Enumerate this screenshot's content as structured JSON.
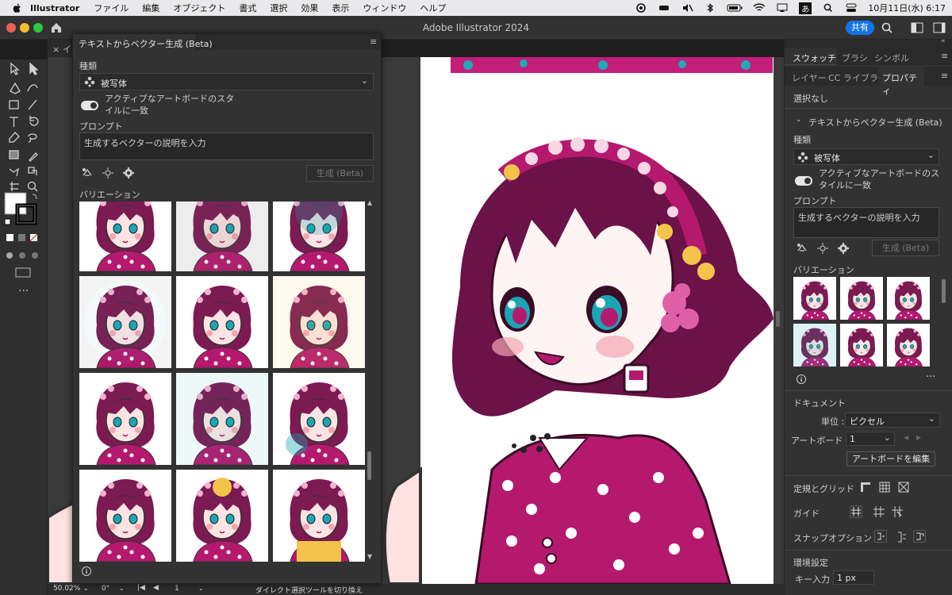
{
  "menubar": {
    "app": "Illustrator",
    "items": [
      "ファイル",
      "編集",
      "オブジェクト",
      "書式",
      "選択",
      "効果",
      "表示",
      "ウィンドウ",
      "ヘルプ"
    ],
    "ime": "あ",
    "clock": "10月11日(水) 6:17"
  },
  "window": {
    "title": "Adobe Illustrator 2024",
    "share": "共有"
  },
  "doc_tab": {
    "label": "イ"
  },
  "panel": {
    "title": "テキストからベクター生成 (Beta)",
    "type_label": "種類",
    "type_value": "被写体",
    "toggle_label": "アクティブなアートボードのスタイルに一致",
    "prompt_label": "プロンプト",
    "prompt_placeholder": "生成するベクターの説明を入力",
    "generate": "生成 (Beta)",
    "variations": "バリエーション"
  },
  "status": {
    "zoom": "50.02%",
    "angle": "0°",
    "artboard": "1",
    "message": "ダイレクト選択ツールを切り換え"
  },
  "rpanel": {
    "tabs_top": [
      "スウォッチ",
      "ブラシ",
      "シンボル"
    ],
    "tabs_bottom": [
      "レイヤー",
      "CC ライブラリ",
      "プロパティ"
    ],
    "selection": "選択なし",
    "section": "テキストからベクター生成 (Beta)",
    "type_label": "種類",
    "type_value": "被写体",
    "toggle_label": "アクティブなアートボードのスタイルに一致",
    "prompt_label": "プロンプト",
    "prompt_placeholder": "生成するベクターの説明を入力",
    "generate": "生成 (Beta)",
    "variations": "バリエーション",
    "document": "ドキュメント",
    "unit_label": "単位 :",
    "unit_value": "ピクセル",
    "artboard_label": "アートボード :",
    "artboard_value": "1",
    "edit_artboard": "アートボードを編集",
    "rulers": "定規とグリッド",
    "guides": "ガイド",
    "snap": "スナップオプション",
    "prefs": "環境設定",
    "key_label": "キー入力 :",
    "key_value": "1 px"
  },
  "colors": {
    "accent": "#1473e6",
    "magenta": "#b5196e",
    "hair": "#6b1248",
    "teal": "#1aa6b4",
    "yellow": "#f4c44a"
  }
}
